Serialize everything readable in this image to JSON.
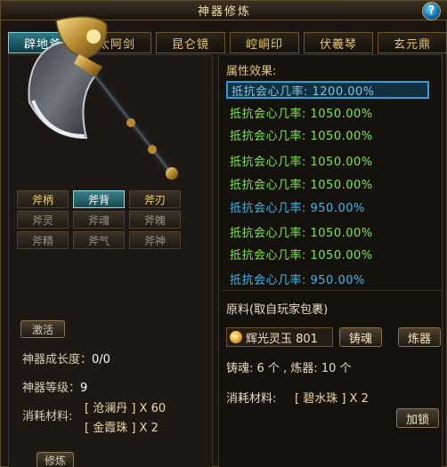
{
  "window": {
    "title": "神器修炼",
    "help_icon": "question-icon",
    "help_label": "?"
  },
  "tabs": [
    {
      "label": "辟地斧",
      "active": true
    },
    {
      "label": "太阿剑",
      "active": false
    },
    {
      "label": "昆仑镜",
      "active": false
    },
    {
      "label": "崆峒印",
      "active": false
    },
    {
      "label": "伏羲琴",
      "active": false
    },
    {
      "label": "玄元鼎",
      "active": false
    }
  ],
  "weapon": {
    "icon": "axe-icon"
  },
  "parts": [
    {
      "label": "斧柄",
      "state": "on"
    },
    {
      "label": "斧背",
      "state": "selected"
    },
    {
      "label": "斧刃",
      "state": "on"
    },
    {
      "label": "斧灵",
      "state": "off"
    },
    {
      "label": "斧魂",
      "state": "off"
    },
    {
      "label": "斧魄",
      "state": "off"
    },
    {
      "label": "斧精",
      "state": "off"
    },
    {
      "label": "斧气",
      "state": "off"
    },
    {
      "label": "斧神",
      "state": "off"
    }
  ],
  "left": {
    "activate_label": "激活",
    "growth_label": "神器成长度：",
    "growth_value": "0/0",
    "level_label": "神器等级：",
    "level_value": "9",
    "cost_label": "消耗材料:",
    "cost_items": [
      "[ 沧澜丹 ] X 60",
      "[ 金霞珠 ] X 2"
    ],
    "train_label": "修炼"
  },
  "attributes": {
    "header": "属性效果:",
    "rows": [
      {
        "text": "抵抗会心几率: 1200.00%",
        "color": "selected"
      },
      {
        "text": "抵抗会心几率: 1050.00%",
        "color": "green"
      },
      {
        "text": "抵抗会心几率: 1050.00%",
        "color": "green"
      },
      {
        "text": "抵抗会心几率: 1050.00%",
        "color": "green"
      },
      {
        "text": "抵抗会心几率: 1050.00%",
        "color": "green"
      },
      {
        "text": "抵抗会心几率: 950.00%",
        "color": "blue"
      },
      {
        "text": "抵抗会心几率: 1050.00%",
        "color": "green"
      },
      {
        "text": "抵抗会心几率: 1050.00%",
        "color": "green"
      },
      {
        "text": "抵抗会心几率: 950.00%",
        "color": "blue"
      }
    ]
  },
  "materials": {
    "header": "原料(取自玩家包裹)",
    "item_icon": "gem-icon",
    "item_text": "辉光灵玉 801",
    "cast_soul_label": "铸魂",
    "forge_label": "炼器",
    "counts_text": "铸魂: 6 个 , 炼器: 10 个",
    "cost_label": "消耗材料:",
    "cost_item": "[ 碧水珠 ] X 2",
    "lock_label": "加锁"
  }
}
